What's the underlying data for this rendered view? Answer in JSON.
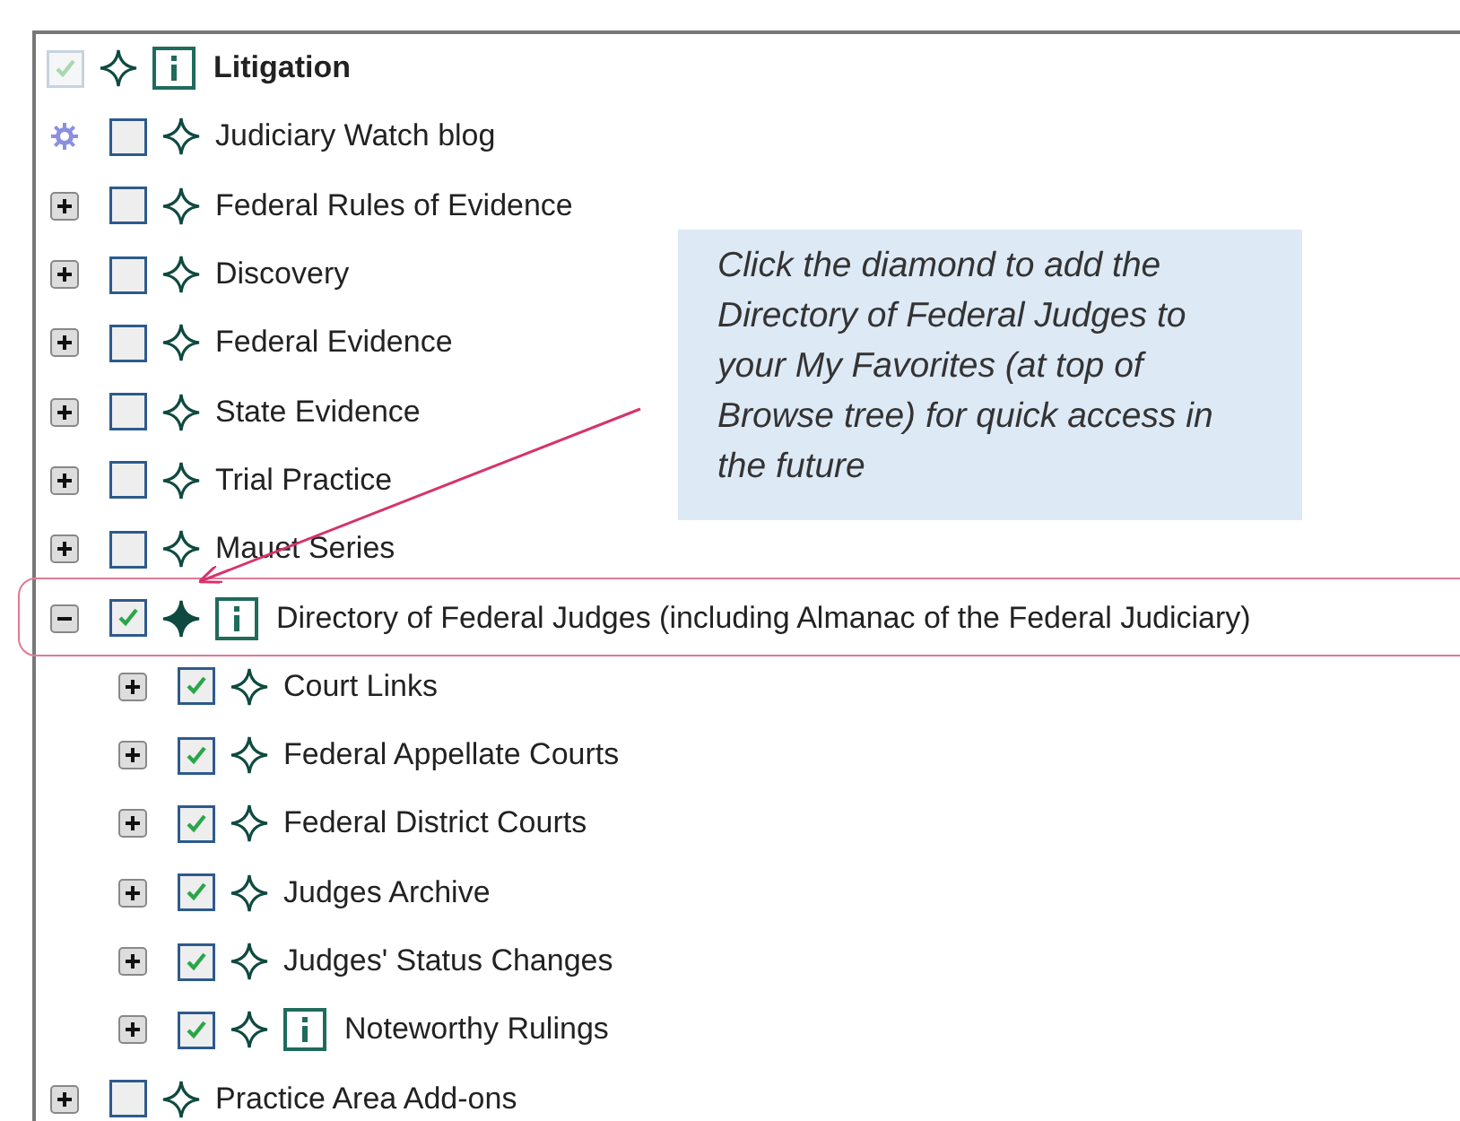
{
  "tree": {
    "label": "Litigation",
    "checked": true,
    "disabled": true,
    "favorite": false,
    "info": true,
    "children": [
      {
        "kind": "feed",
        "label": "Judiciary Watch blog",
        "checked": false,
        "favorite": false,
        "info": false
      },
      {
        "kind": "folder",
        "expanded": false,
        "label": "Federal Rules of Evidence",
        "checked": false,
        "favorite": false,
        "info": false
      },
      {
        "kind": "folder",
        "expanded": false,
        "label": "Discovery",
        "checked": false,
        "favorite": false,
        "info": false
      },
      {
        "kind": "folder",
        "expanded": false,
        "label": "Federal Evidence",
        "checked": false,
        "favorite": false,
        "info": false
      },
      {
        "kind": "folder",
        "expanded": false,
        "label": "State Evidence",
        "checked": false,
        "favorite": false,
        "info": false
      },
      {
        "kind": "folder",
        "expanded": false,
        "label": "Trial Practice",
        "checked": false,
        "favorite": false,
        "info": false
      },
      {
        "kind": "folder",
        "expanded": false,
        "label": "Mauet Series",
        "checked": false,
        "favorite": false,
        "info": false
      },
      {
        "kind": "folder",
        "expanded": true,
        "label": "Directory of Federal Judges (including Almanac of the Federal Judiciary)",
        "checked": true,
        "favorite": true,
        "info": true,
        "highlighted": true,
        "children": [
          {
            "kind": "folder",
            "expanded": false,
            "label": "Court Links",
            "checked": true,
            "favorite": false,
            "info": false
          },
          {
            "kind": "folder",
            "expanded": false,
            "label": "Federal Appellate Courts",
            "checked": true,
            "favorite": false,
            "info": false
          },
          {
            "kind": "folder",
            "expanded": false,
            "label": "Federal District Courts",
            "checked": true,
            "favorite": false,
            "info": false
          },
          {
            "kind": "folder",
            "expanded": false,
            "label": "Judges Archive",
            "checked": true,
            "favorite": false,
            "info": false
          },
          {
            "kind": "folder",
            "expanded": false,
            "label": "Judges' Status Changes",
            "checked": true,
            "favorite": false,
            "info": false
          },
          {
            "kind": "folder",
            "expanded": false,
            "label": "Noteworthy Rulings",
            "checked": true,
            "favorite": false,
            "info": true
          }
        ]
      },
      {
        "kind": "folder",
        "expanded": false,
        "label": "Practice Area Add-ons",
        "checked": false,
        "favorite": false,
        "info": false
      }
    ]
  },
  "callout": {
    "text": "Click the diamond to add the Directory of Federal Judges to your My Favorites (at top of Browse tree) for quick access in the future"
  }
}
